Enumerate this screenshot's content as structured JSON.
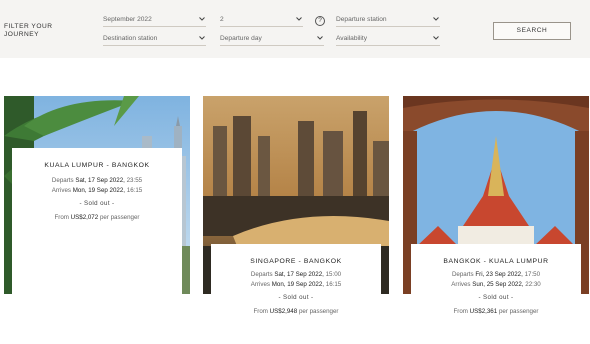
{
  "filter": {
    "title_line1": "FILTER YOUR",
    "title_line2": "JOURNEY",
    "month": "September 2022",
    "passengers": "2",
    "info": "?",
    "departure_station": "Departure station",
    "destination_station": "Destination station",
    "departure_day": "Departure day",
    "availability": "Availability",
    "search_label": "SEARCH"
  },
  "cards": [
    {
      "route": "KUALA LUMPUR - BANGKOK",
      "departs_label": "Departs",
      "departs_value": "Sat, 17 Sep 2022,",
      "departs_time": "23:55",
      "arrives_label": "Arrives",
      "arrives_value": "Mon, 19 Sep 2022,",
      "arrives_time": "16:15",
      "status": "- Sold out -",
      "price_prefix": "From",
      "price": "US$2,072",
      "price_suffix": "per passenger"
    },
    {
      "route": "SINGAPORE - BANGKOK",
      "departs_label": "Departs",
      "departs_value": "Sat, 17 Sep 2022,",
      "departs_time": "15:00",
      "arrives_label": "Arrives",
      "arrives_value": "Mon, 19 Sep 2022,",
      "arrives_time": "16:15",
      "status": "- Sold out -",
      "price_prefix": "From",
      "price": "US$2,948",
      "price_suffix": "per passenger"
    },
    {
      "route": "BANGKOK - KUALA LUMPUR",
      "departs_label": "Departs",
      "departs_value": "Fri, 23 Sep 2022,",
      "departs_time": "17:50",
      "arrives_label": "Arrives",
      "arrives_value": "Sun, 25 Sep 2022,",
      "arrives_time": "22:30",
      "status": "- Sold out -",
      "price_prefix": "From",
      "price": "US$2,361",
      "price_suffix": "per passenger"
    }
  ],
  "icons": {
    "dropdown": "chevron-down-icon",
    "info": "info-icon"
  },
  "colors": {
    "filter_bg": "#f5f4f2",
    "text": "#3a3a3a",
    "divider": "#cfcac2"
  }
}
